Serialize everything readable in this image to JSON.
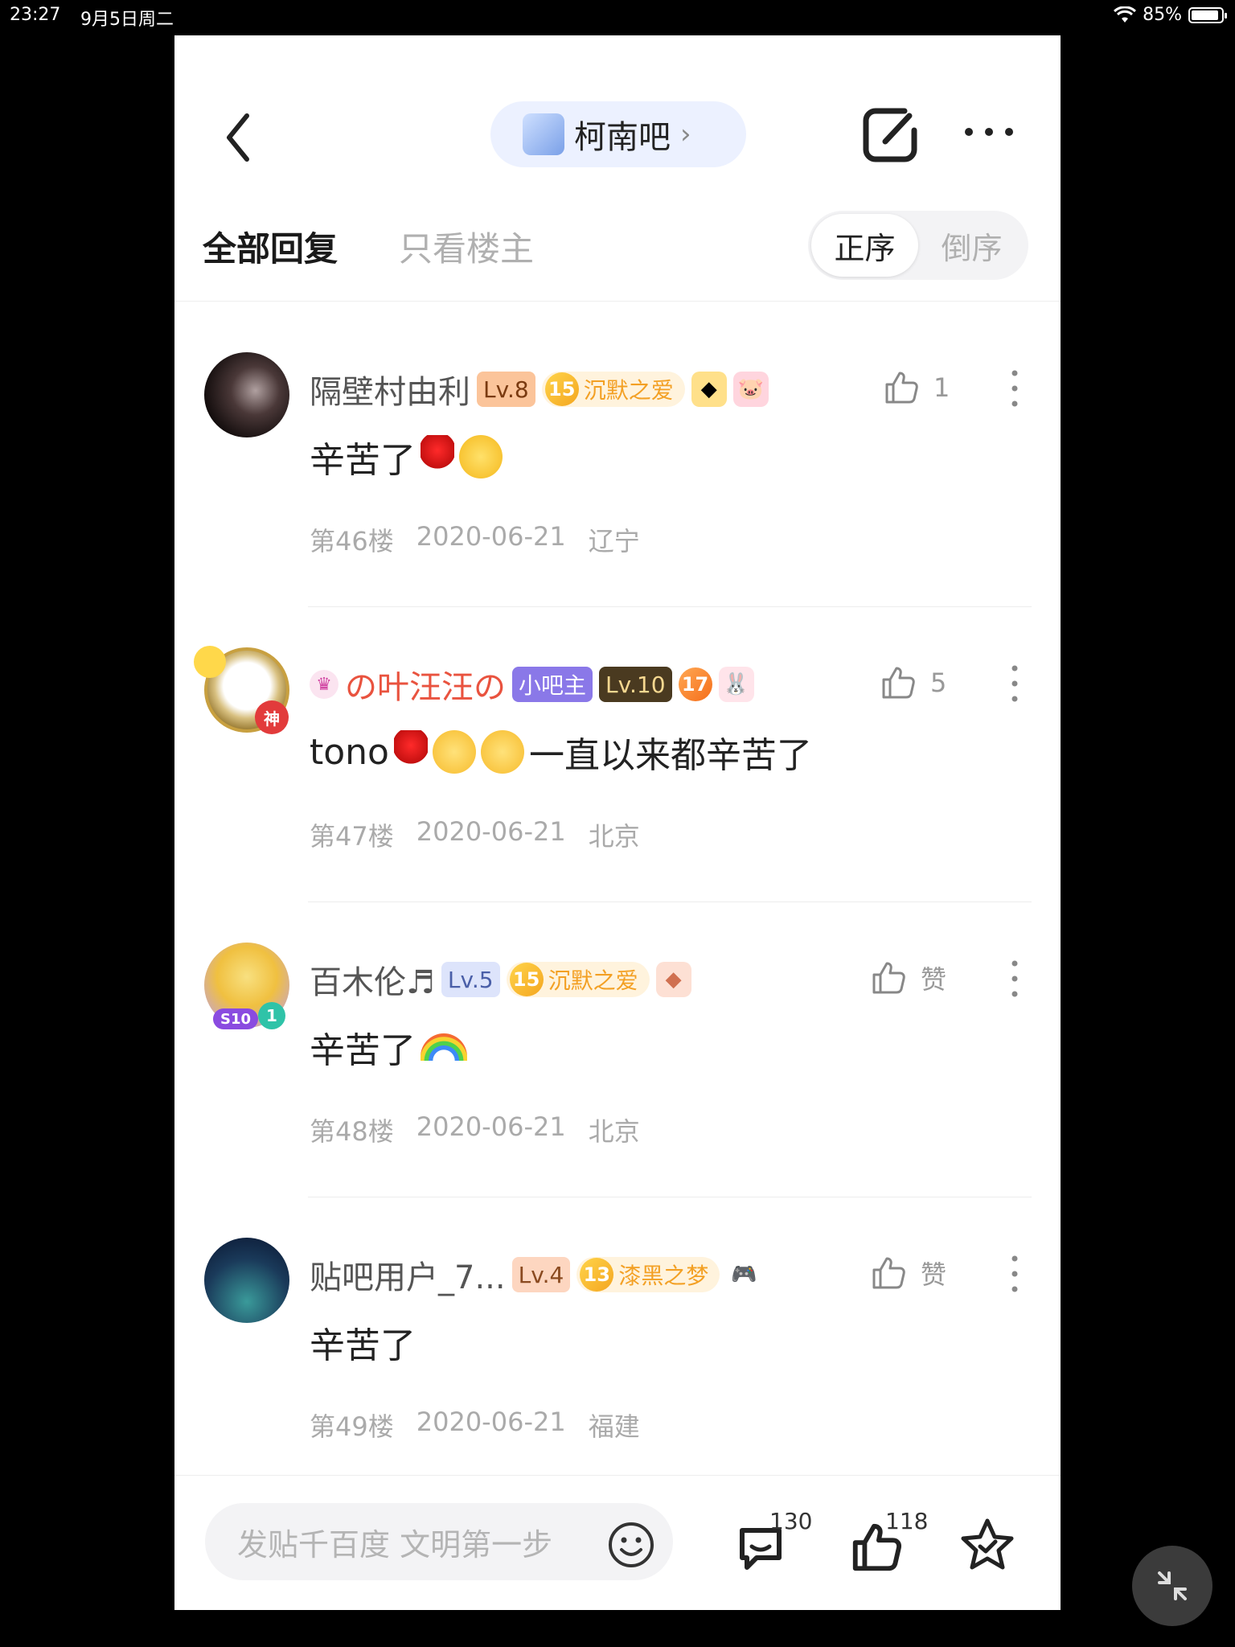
{
  "status": {
    "time": "23:27",
    "date": "9月5日周二",
    "battery": "85%",
    "battery_level": 0.85
  },
  "header": {
    "forum_name": "柯南吧",
    "tabs": [
      {
        "label": "全部回复",
        "active": true
      },
      {
        "label": "只看楼主",
        "active": false
      }
    ],
    "sort": [
      {
        "label": "正序",
        "active": true
      },
      {
        "label": "倒序",
        "active": false
      }
    ]
  },
  "replies": [
    {
      "username": "隔壁村由利",
      "level": "Lv.8",
      "fan_level": "15",
      "fan_title": "沉默之爱",
      "text": "辛苦了",
      "emojis": [
        "rose-emoji",
        "pleading-face-emoji"
      ],
      "likes": "1",
      "floor": "第46楼",
      "date": "2020-06-21",
      "location": "辽宁"
    },
    {
      "username": "の叶汪汪の",
      "role": "小吧主",
      "level": "Lv.10",
      "fan_level": "17",
      "avatar_badge": "神",
      "text_pre": "tono",
      "text_post": "一直以来都辛苦了",
      "emojis": [
        "rose-emoji",
        "blush-face-emoji",
        "blush-face-emoji"
      ],
      "likes": "5",
      "floor": "第47楼",
      "date": "2020-06-21",
      "location": "北京"
    },
    {
      "username": "百木伦♬",
      "level": "Lv.5",
      "fan_level": "15",
      "fan_title": "沉默之爱",
      "avatar_badge_text": "S10",
      "avatar_badge_num": "1",
      "text": "辛苦了",
      "emojis": [
        "rainbow-emoji"
      ],
      "likes": "赞",
      "floor": "第48楼",
      "date": "2020-06-21",
      "location": "北京"
    },
    {
      "username": "贴吧用户_7...",
      "level": "Lv.4",
      "fan_level": "13",
      "fan_title": "漆黑之梦",
      "text": "辛苦了",
      "likes": "赞",
      "floor": "第49楼",
      "date": "2020-06-21",
      "location": "福建"
    }
  ],
  "bottom": {
    "composer_placeholder": "发贴千百度 文明第一步",
    "comment_count": "130",
    "like_count": "118"
  },
  "colors": {
    "accent_pill": "#ecf1ff",
    "special_name": "#e9533f",
    "moderator": "#8a78e8"
  }
}
